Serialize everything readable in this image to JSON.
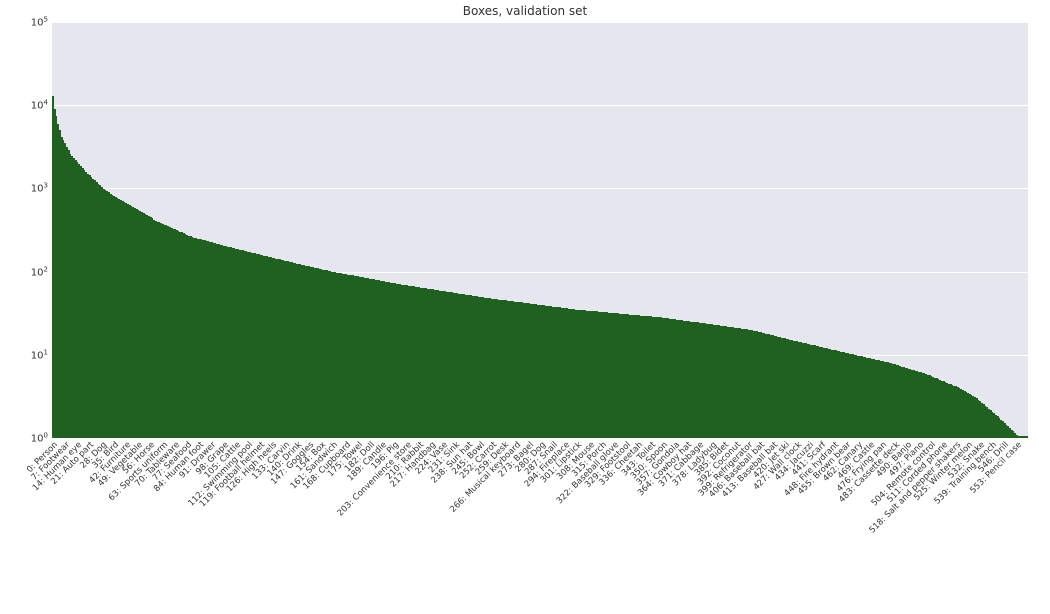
{
  "chart_data": {
    "type": "bar",
    "title": "Boxes, validation set",
    "xlabel": "",
    "ylabel": "",
    "yscale": "log",
    "ylim": [
      1,
      100000
    ],
    "yticks": [
      1,
      10,
      100,
      1000,
      10000,
      100000
    ],
    "ytick_labels": [
      "10⁰",
      "10¹",
      "10²",
      "10³",
      "10⁴",
      "10⁵"
    ],
    "n_bars": 560,
    "x_tick_labels": [
      {
        "idx": 0,
        "label": "0: Person"
      },
      {
        "idx": 7,
        "label": "7: Footwear"
      },
      {
        "idx": 14,
        "label": "14: Human eye"
      },
      {
        "idx": 21,
        "label": "21: Auto part"
      },
      {
        "idx": 28,
        "label": "28: Dog"
      },
      {
        "idx": 35,
        "label": "35: Bird"
      },
      {
        "idx": 42,
        "label": "42: Furniture"
      },
      {
        "idx": 49,
        "label": "49: Vegetable"
      },
      {
        "idx": 56,
        "label": "56: Horse"
      },
      {
        "idx": 63,
        "label": "63: Sports uniform"
      },
      {
        "idx": 70,
        "label": "70: Tableware"
      },
      {
        "idx": 77,
        "label": "77: Seafood"
      },
      {
        "idx": 84,
        "label": "84: Human foot"
      },
      {
        "idx": 91,
        "label": "91: Drawer"
      },
      {
        "idx": 98,
        "label": "98: Grape"
      },
      {
        "idx": 105,
        "label": "105: Cattle"
      },
      {
        "idx": 112,
        "label": "112: Swimming pool"
      },
      {
        "idx": 119,
        "label": "119: Football helmet"
      },
      {
        "idx": 126,
        "label": "126: High heels"
      },
      {
        "idx": 133,
        "label": "133: Carvin"
      },
      {
        "idx": 140,
        "label": "140: Drink"
      },
      {
        "idx": 147,
        "label": "147: Goggles"
      },
      {
        "idx": 154,
        "label": "154: Box"
      },
      {
        "idx": 161,
        "label": "161: Sandwich"
      },
      {
        "idx": 168,
        "label": "168: Cupboard"
      },
      {
        "idx": 175,
        "label": "175: Towel"
      },
      {
        "idx": 182,
        "label": "182: Doll"
      },
      {
        "idx": 189,
        "label": "189: Candle"
      },
      {
        "idx": 196,
        "label": "196: Pig"
      },
      {
        "idx": 203,
        "label": "203: Convenience store"
      },
      {
        "idx": 210,
        "label": "210: Rabbit"
      },
      {
        "idx": 217,
        "label": "217: Handbag"
      },
      {
        "idx": 224,
        "label": "224: Vase"
      },
      {
        "idx": 231,
        "label": "231: Sink"
      },
      {
        "idx": 238,
        "label": "238: Sun hat"
      },
      {
        "idx": 245,
        "label": "245: Bowl"
      },
      {
        "idx": 252,
        "label": "252: Carrot"
      },
      {
        "idx": 259,
        "label": "259: Desk"
      },
      {
        "idx": 266,
        "label": "266: Musical keyboard"
      },
      {
        "idx": 273,
        "label": "273: Bagel"
      },
      {
        "idx": 280,
        "label": "280: Dog"
      },
      {
        "idx": 287,
        "label": "287: Snail"
      },
      {
        "idx": 294,
        "label": "294: Fireplace"
      },
      {
        "idx": 301,
        "label": "301: Lipstick"
      },
      {
        "idx": 308,
        "label": "308: Mouse"
      },
      {
        "idx": 315,
        "label": "315: Porch"
      },
      {
        "idx": 322,
        "label": "322: Baseball glove"
      },
      {
        "idx": 329,
        "label": "329: Footstool"
      },
      {
        "idx": 336,
        "label": "336: Cheetah"
      },
      {
        "idx": 343,
        "label": "343: Toilet"
      },
      {
        "idx": 350,
        "label": "350: Spoon"
      },
      {
        "idx": 357,
        "label": "357: Gondola"
      },
      {
        "idx": 364,
        "label": "364: Cowboy hat"
      },
      {
        "idx": 371,
        "label": "371: Cabbage"
      },
      {
        "idx": 378,
        "label": "378: Ladybug"
      },
      {
        "idx": 385,
        "label": "385: Bidet"
      },
      {
        "idx": 392,
        "label": "392: Coconut"
      },
      {
        "idx": 399,
        "label": "399: Refrigerator"
      },
      {
        "idx": 406,
        "label": "406: Baseball bat"
      },
      {
        "idx": 413,
        "label": "413: Baseball bat"
      },
      {
        "idx": 420,
        "label": "420: Jet ski"
      },
      {
        "idx": 427,
        "label": "427: Wall clock"
      },
      {
        "idx": 434,
        "label": "434: Jacuzzi"
      },
      {
        "idx": 441,
        "label": "441: Scarf"
      },
      {
        "idx": 448,
        "label": "448: Fire hydrant"
      },
      {
        "idx": 455,
        "label": "455: Brown bear"
      },
      {
        "idx": 462,
        "label": "462: Canary"
      },
      {
        "idx": 469,
        "label": "469: Castle"
      },
      {
        "idx": 476,
        "label": "476: Frying pan"
      },
      {
        "idx": 483,
        "label": "483: Cassette deck"
      },
      {
        "idx": 490,
        "label": "490: Banjo"
      },
      {
        "idx": 497,
        "label": "497: Piano"
      },
      {
        "idx": 504,
        "label": "504: Remote control"
      },
      {
        "idx": 511,
        "label": "511: Corded phone"
      },
      {
        "idx": 518,
        "label": "518: Salt and pepper shakers"
      },
      {
        "idx": 525,
        "label": "525: Winter melon"
      },
      {
        "idx": 532,
        "label": "532: Snake"
      },
      {
        "idx": 539,
        "label": "539: Training bench"
      },
      {
        "idx": 546,
        "label": "546: Drill"
      },
      {
        "idx": 553,
        "label": "553: Pencil case"
      }
    ],
    "values_sample": [
      {
        "rank": 0,
        "value": 13000
      },
      {
        "rank": 1,
        "value": 9000
      },
      {
        "rank": 3,
        "value": 6000
      },
      {
        "rank": 5,
        "value": 4200
      },
      {
        "rank": 10,
        "value": 2600
      },
      {
        "rank": 20,
        "value": 1500
      },
      {
        "rank": 30,
        "value": 950
      },
      {
        "rank": 40,
        "value": 700
      },
      {
        "rank": 60,
        "value": 400
      },
      {
        "rank": 80,
        "value": 260
      },
      {
        "rank": 100,
        "value": 200
      },
      {
        "rank": 130,
        "value": 140
      },
      {
        "rank": 160,
        "value": 100
      },
      {
        "rank": 200,
        "value": 70
      },
      {
        "rank": 250,
        "value": 48
      },
      {
        "rank": 300,
        "value": 35
      },
      {
        "rank": 350,
        "value": 28
      },
      {
        "rank": 400,
        "value": 20
      },
      {
        "rank": 430,
        "value": 14
      },
      {
        "rank": 460,
        "value": 10
      },
      {
        "rank": 480,
        "value": 8
      },
      {
        "rank": 500,
        "value": 6
      },
      {
        "rank": 520,
        "value": 4
      },
      {
        "rank": 530,
        "value": 3
      },
      {
        "rank": 540,
        "value": 2
      },
      {
        "rank": 555,
        "value": 1
      },
      {
        "rank": 559,
        "value": 1
      }
    ]
  }
}
